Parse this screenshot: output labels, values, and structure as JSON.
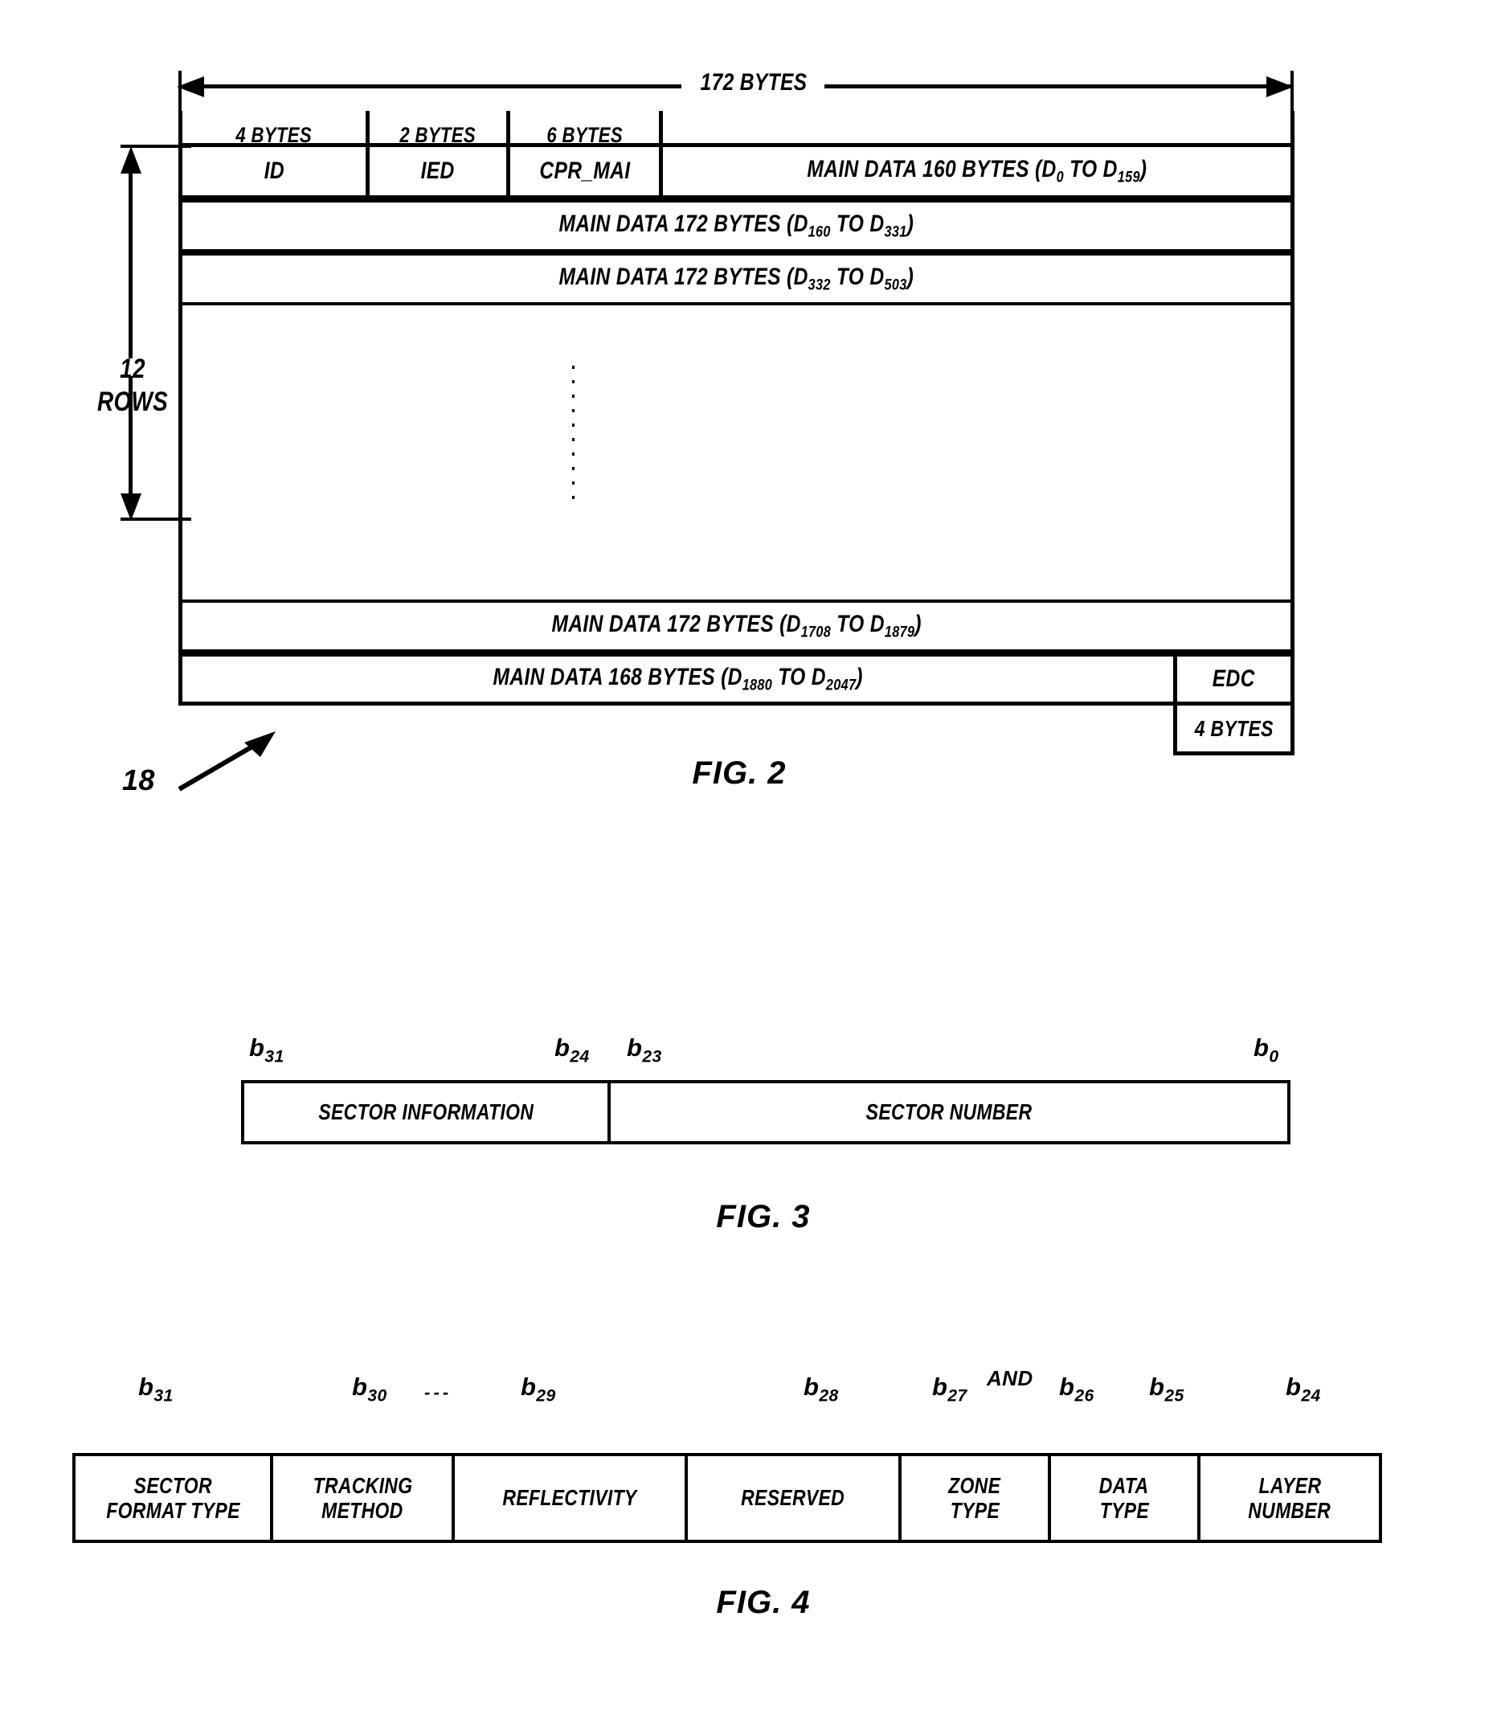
{
  "figures": {
    "fig2": {
      "label": "FIG. 2",
      "reference_numeral": "18",
      "total_width_label": "172 BYTES",
      "rows_label_number": "12",
      "rows_label_word": "ROWS",
      "header_cells": [
        {
          "label": "4 BYTES"
        },
        {
          "label": "2 BYTES"
        },
        {
          "label": "6 BYTES"
        }
      ],
      "first_row_fields": [
        {
          "label": "ID"
        },
        {
          "label": "IED"
        },
        {
          "label": "CPR_MAI"
        }
      ],
      "data_rows": [
        {
          "prefix": "MAIN DATA 160 BYTES (D",
          "from": "0",
          "mid": " TO D",
          "to": "159",
          "suffix": ")"
        },
        {
          "prefix": "MAIN DATA 172 BYTES (D",
          "from": "160",
          "mid": " TO D",
          "to": "331",
          "suffix": ")"
        },
        {
          "prefix": "MAIN DATA 172 BYTES (D",
          "from": "332",
          "mid": " TO D",
          "to": "503",
          "suffix": ")"
        },
        {
          "prefix": "MAIN DATA 172 BYTES (D",
          "from": "1708",
          "mid": " TO D",
          "to": "1879",
          "suffix": ")"
        },
        {
          "prefix": "MAIN DATA 168 BYTES (D",
          "from": "1880",
          "mid": " TO D",
          "to": "2047",
          "suffix": ")"
        }
      ],
      "edc": {
        "label": "EDC",
        "size_label": "4 BYTES"
      }
    },
    "fig3": {
      "label": "FIG. 3",
      "bit_labels": [
        {
          "base": "b",
          "sub": "31"
        },
        {
          "base": "b",
          "sub": "24"
        },
        {
          "base": "b",
          "sub": "23"
        },
        {
          "base": "b",
          "sub": "0"
        }
      ],
      "fields": [
        {
          "label": "SECTOR INFORMATION"
        },
        {
          "label": "SECTOR NUMBER"
        }
      ]
    },
    "fig4": {
      "label": "FIG. 4",
      "ellipsis": "- - -",
      "and_word": "AND",
      "bit_labels": [
        {
          "base": "b",
          "sub": "31"
        },
        {
          "base": "b",
          "sub": "30"
        },
        {
          "base": "b",
          "sub": "29"
        },
        {
          "base": "b",
          "sub": "28"
        },
        {
          "base": "b",
          "sub": "27"
        },
        {
          "base": "b",
          "sub": "26"
        },
        {
          "base": "b",
          "sub": "25"
        },
        {
          "base": "b",
          "sub": "24"
        }
      ],
      "fields": [
        {
          "line1": "SECTOR",
          "line2": "FORMAT TYPE"
        },
        {
          "line1": "TRACKING",
          "line2": "METHOD"
        },
        {
          "line1": "REFLECTIVITY",
          "line2": ""
        },
        {
          "line1": "RESERVED",
          "line2": ""
        },
        {
          "line1": "ZONE",
          "line2": "TYPE"
        },
        {
          "line1": "DATA",
          "line2": "TYPE"
        },
        {
          "line1": "LAYER",
          "line2": "NUMBER"
        }
      ]
    }
  },
  "colors": {
    "ink": "#000000",
    "paper": "#ffffff"
  }
}
